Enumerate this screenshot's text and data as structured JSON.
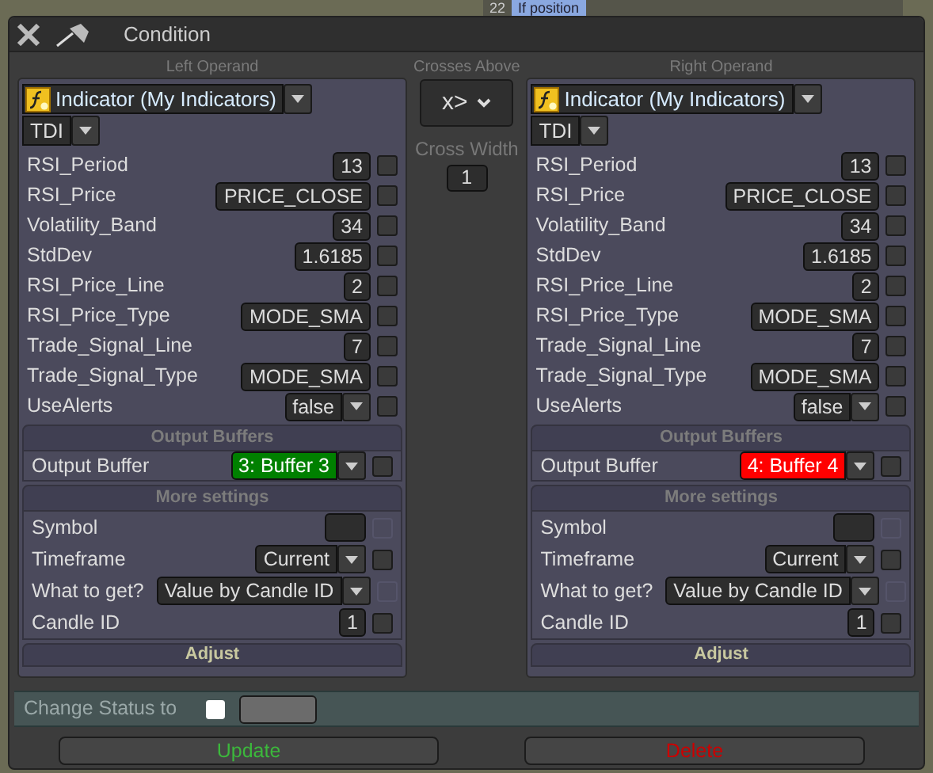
{
  "background": {
    "row_number": "22",
    "row_text": "If position"
  },
  "window": {
    "title": "Condition"
  },
  "operands": [
    {
      "title": "Left Operand",
      "source": "Indicator (My Indicators)",
      "indicator": "TDI",
      "params": [
        {
          "label": "RSI_Period",
          "value": "13",
          "kind": "number",
          "checked": false
        },
        {
          "label": "RSI_Price",
          "value": "PRICE_CLOSE",
          "kind": "number",
          "checked": false
        },
        {
          "label": "Volatility_Band",
          "value": "34",
          "kind": "number",
          "checked": false
        },
        {
          "label": "StdDev",
          "value": "1.6185",
          "kind": "number",
          "checked": false
        },
        {
          "label": "RSI_Price_Line",
          "value": "2",
          "kind": "number",
          "checked": false
        },
        {
          "label": "RSI_Price_Type",
          "value": "MODE_SMA",
          "kind": "number",
          "checked": false
        },
        {
          "label": "Trade_Signal_Line",
          "value": "7",
          "kind": "number",
          "checked": false
        },
        {
          "label": "Trade_Signal_Type",
          "value": "MODE_SMA",
          "kind": "number",
          "checked": false
        },
        {
          "label": "UseAlerts",
          "value": "false",
          "kind": "dropdown",
          "checked": false
        }
      ],
      "output_header": "Output Buffers",
      "output": {
        "label": "Output Buffer",
        "value": "3: Buffer 3",
        "color": "#008000",
        "checked": false
      },
      "more_header": "More settings",
      "more": [
        {
          "label": "Symbol",
          "kind": "field",
          "checked": false,
          "disabled": true
        },
        {
          "label": "Timeframe",
          "value": "Current",
          "kind": "dropdown",
          "checked": false,
          "disabled": false
        },
        {
          "label": "What to get?",
          "value": "Value by Candle ID",
          "kind": "dropdown",
          "checked": false,
          "disabled": true
        },
        {
          "label": "Candle ID",
          "value": "1",
          "kind": "number",
          "checked": false,
          "disabled": false
        }
      ],
      "adjust": "Adjust"
    },
    {
      "title": "Right Operand",
      "source": "Indicator (My Indicators)",
      "indicator": "TDI",
      "params": [
        {
          "label": "RSI_Period",
          "value": "13",
          "kind": "number",
          "checked": false
        },
        {
          "label": "RSI_Price",
          "value": "PRICE_CLOSE",
          "kind": "number",
          "checked": false
        },
        {
          "label": "Volatility_Band",
          "value": "34",
          "kind": "number",
          "checked": false
        },
        {
          "label": "StdDev",
          "value": "1.6185",
          "kind": "number",
          "checked": false
        },
        {
          "label": "RSI_Price_Line",
          "value": "2",
          "kind": "number",
          "checked": false
        },
        {
          "label": "RSI_Price_Type",
          "value": "MODE_SMA",
          "kind": "number",
          "checked": false
        },
        {
          "label": "Trade_Signal_Line",
          "value": "7",
          "kind": "number",
          "checked": false
        },
        {
          "label": "Trade_Signal_Type",
          "value": "MODE_SMA",
          "kind": "number",
          "checked": false
        },
        {
          "label": "UseAlerts",
          "value": "false",
          "kind": "dropdown",
          "checked": false
        }
      ],
      "output_header": "Output Buffers",
      "output": {
        "label": "Output Buffer",
        "value": "4: Buffer 4",
        "color": "#ff0000",
        "checked": false
      },
      "more_header": "More settings",
      "more": [
        {
          "label": "Symbol",
          "kind": "field",
          "checked": false,
          "disabled": true
        },
        {
          "label": "Timeframe",
          "value": "Current",
          "kind": "dropdown",
          "checked": false,
          "disabled": false
        },
        {
          "label": "What to get?",
          "value": "Value by Candle ID",
          "kind": "dropdown",
          "checked": false,
          "disabled": true
        },
        {
          "label": "Candle ID",
          "value": "1",
          "kind": "number",
          "checked": false,
          "disabled": false
        }
      ],
      "adjust": "Adjust"
    }
  ],
  "cross": {
    "title": "Crosses Above",
    "operator": "x>",
    "width_label": "Cross Width",
    "width_value": "1"
  },
  "status": {
    "label": "Change Status to",
    "checked": false
  },
  "buttons": [
    {
      "label": "Update",
      "kind": "update"
    },
    {
      "label": "Delete",
      "kind": "delete"
    }
  ]
}
